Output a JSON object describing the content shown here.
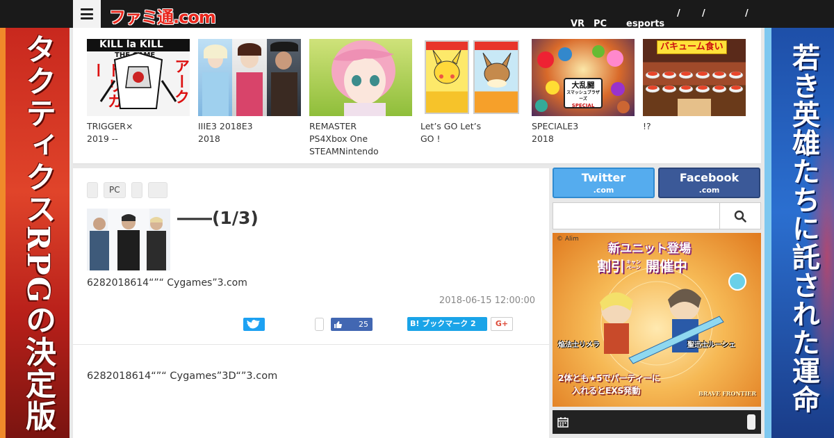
{
  "header": {
    "logo": "ファミ通.com",
    "nav": [
      {
        "label": "VR"
      },
      {
        "label": "PC"
      },
      {
        "label": "esports"
      },
      {
        "label": "/"
      },
      {
        "label": "/"
      },
      {
        "label": "/"
      }
    ]
  },
  "banners": {
    "left_text": "タクティクスRPGの決定版",
    "right_text": "若き英雄たちに託された運命"
  },
  "carousel": [
    {
      "line1": "TRIGGER×",
      "line2": "2019  --",
      "line3": "",
      "art_text1": "KILL la KILL",
      "art_text2": "THE GAME",
      "art_text3": "トリガー",
      "art_text4": "アーク"
    },
    {
      "line1": "IIIE3 2018E3",
      "line2": "2018",
      "line3": ""
    },
    {
      "line1": "REMASTER",
      "line2": "PS4Xbox One",
      "line3": "STEAMNintendo"
    },
    {
      "line1": "Let’s GO Let’s",
      "line2": "GO !",
      "line3": ""
    },
    {
      "line1": "SPECIALE3",
      "line2": "2018",
      "line3": "",
      "art_text1": "大乱闘",
      "art_text2": "スマッシュブラザーズ",
      "art_text3": "SPECIAL"
    },
    {
      "line1": "!?",
      "line2": "",
      "line3": "",
      "art_text1": "バキューム食い"
    }
  ],
  "article": {
    "tags": [
      "",
      "PC",
      "",
      ""
    ],
    "headline": "――(1/3)",
    "summary": "6282018614“”“ Cygames”3.com",
    "date": "2018-06-15 12:00:00",
    "share": {
      "facebook_count": "25",
      "hatena_label": "B! ブックマーク 2",
      "gplus_label": "G+"
    },
    "body": "6282018614“”“ Cygames”3D“”3.com"
  },
  "sidebar": {
    "twitter_title": "Twitter",
    "twitter_sub": ".com",
    "facebook_title": "Facebook",
    "facebook_sub": ".com",
    "search_placeholder": "",
    "ad": {
      "copyright": "© Alim",
      "headline1": "新ユニット登場",
      "headline2_a": "割引",
      "headline2_b": "キャンペーン",
      "headline2_c": "開催中",
      "name_left": "焔法士リメラ",
      "name_right": "聖迅士ルーシェ",
      "footer1": "2体とも★5でパーティーに",
      "footer2": "入れるとEXS発動",
      "logo": "BRAVE FRONTIER"
    }
  },
  "colors": {
    "twitter": "#55acee",
    "facebook": "#3b5998",
    "hatena": "#1aa4e8",
    "logo_red": "#e8261c"
  }
}
